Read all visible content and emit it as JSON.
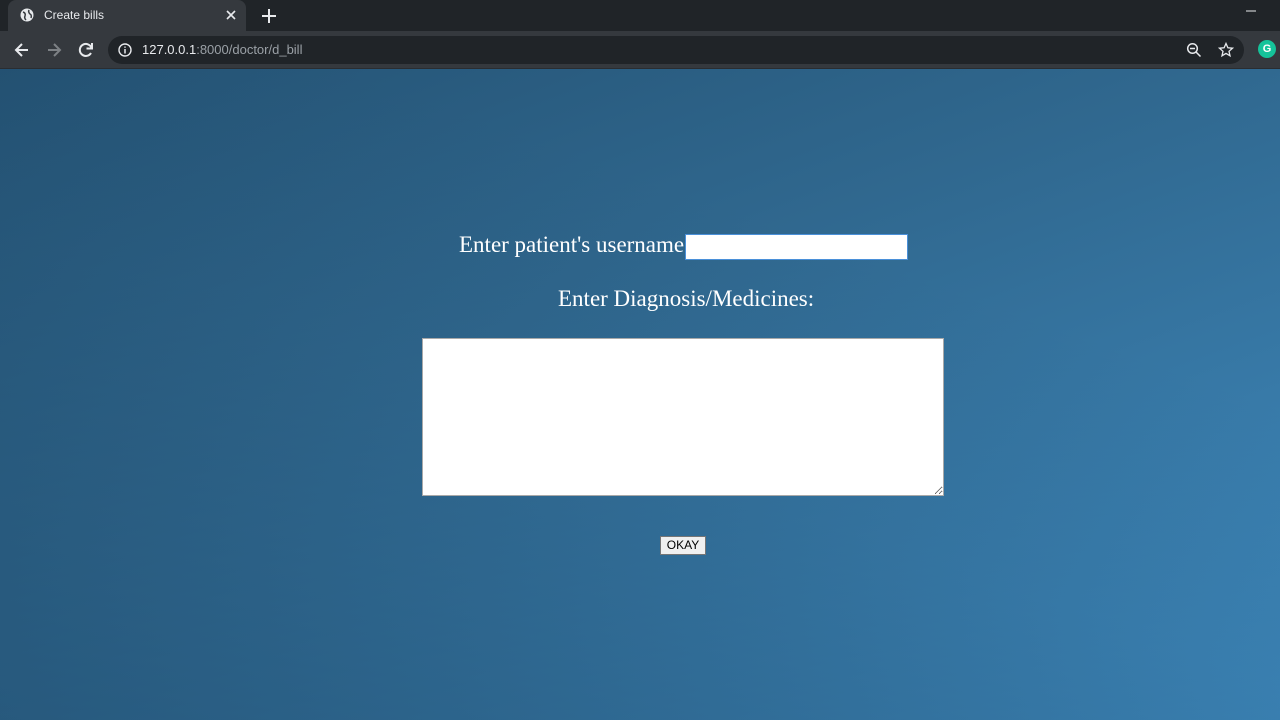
{
  "browser": {
    "tab_title": "Create bills",
    "url_host": "127.0.0.1",
    "url_rest": ":8000/doctor/d_bill",
    "extension_badge": "G"
  },
  "form": {
    "username_label": "Enter patient's username:",
    "username_value": "",
    "diagnosis_label": "Enter Diagnosis/Medicines:",
    "diagnosis_value": "",
    "submit_label": "OKAY"
  }
}
